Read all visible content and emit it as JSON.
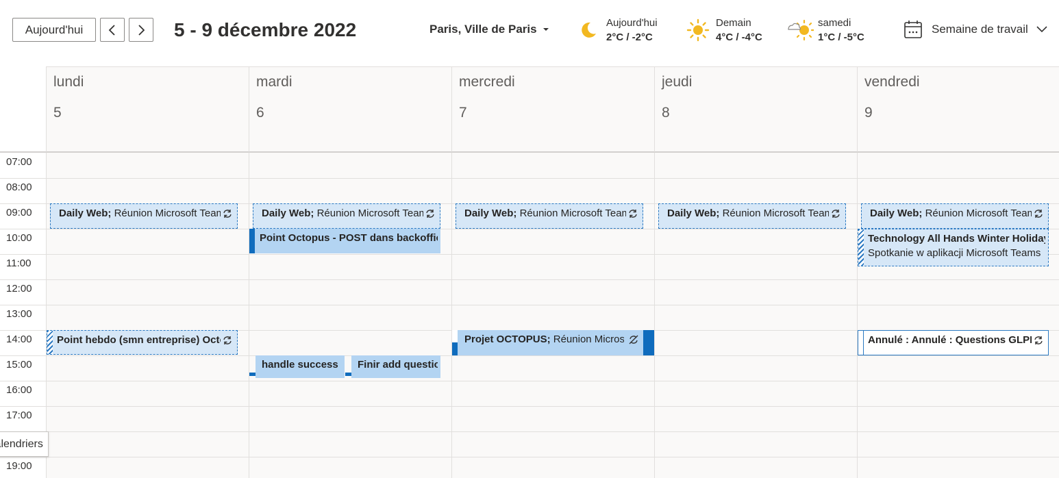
{
  "toolbar": {
    "today_label": "Aujourd'hui",
    "range_title": "5 - 9 décembre 2022",
    "location": "Paris, Ville de Paris",
    "view_label": "Semaine de travail"
  },
  "weather": [
    {
      "day": "Aujourd'hui",
      "temp": "2°C / -2°C",
      "icon": "moon-icon"
    },
    {
      "day": "Demain",
      "temp": "4°C / -4°C",
      "icon": "sun-icon"
    },
    {
      "day": "samedi",
      "temp": "1°C / -5°C",
      "icon": "partly-sunny-icon"
    }
  ],
  "days": [
    {
      "name": "lundi",
      "num": "5"
    },
    {
      "name": "mardi",
      "num": "6"
    },
    {
      "name": "mercredi",
      "num": "7"
    },
    {
      "name": "jeudi",
      "num": "8"
    },
    {
      "name": "vendredi",
      "num": "9"
    }
  ],
  "times": [
    "07:00",
    "08:00",
    "09:00",
    "10:00",
    "11:00",
    "12:00",
    "13:00",
    "14:00",
    "15:00",
    "16:00",
    "17:00",
    "",
    "19:00"
  ],
  "events": {
    "daily": {
      "title": "Daily Web;",
      "rest": " Réunion Microsoft Teams"
    },
    "point_octopus": {
      "title": "Point Octopus - POST dans backoffice"
    },
    "tech_all_hands": {
      "title": "Technology All Hands Winter Holiday",
      "subtitle": "Spotkanie w aplikacji Microsoft Teams"
    },
    "point_hebdo": {
      "title": "Point hebdo (smn entreprise) Octopus"
    },
    "projet_octopus": {
      "title": "Projet OCTOPUS;",
      "rest": " Réunion Microsoft Teams"
    },
    "annule": {
      "title": "Annulé : Annulé : Questions GLPI"
    },
    "handle_success": {
      "title": "handle success"
    },
    "finir_add": {
      "title": "Finir add question"
    }
  },
  "tooltip": "Calendriers",
  "colors": {
    "accent": "#0f6cbd",
    "tentative_bg": "#d6e7f7",
    "busy_bg": "#b3d4f2",
    "grid_bg": "#faf9f8"
  }
}
